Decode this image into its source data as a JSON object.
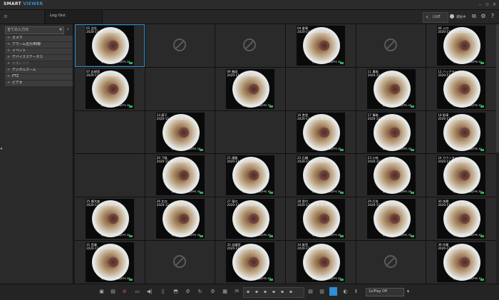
{
  "app": {
    "brand_main": "SMART",
    "brand_sub": "VIEWER"
  },
  "toolbar": {
    "tab_label": "Log Out",
    "status_label": "運転中"
  },
  "sidebar": {
    "selector_value": "全ての入力元",
    "items": [
      {
        "label": "カメラ",
        "enabled": true
      },
      {
        "label": "アラーム出力/制御",
        "enabled": true
      },
      {
        "label": "イベント",
        "enabled": true
      },
      {
        "label": "デバイスステータス",
        "enabled": true
      },
      {
        "label": "お気に入り",
        "enabled": false
      },
      {
        "label": "デジタルズーム",
        "enabled": true
      },
      {
        "label": "PTZ",
        "enabled": true
      },
      {
        "label": "ビデオ",
        "enabled": true
      }
    ]
  },
  "grid": {
    "cells": [
      {
        "label": "01 会社",
        "time": "2020-11-26 11:04:25",
        "status": "帯域 38.3 Mbps/FPS 30",
        "selected": true
      },
      {
        "empty": true
      },
      {
        "empty": true
      },
      {
        "label": "04 倉庫",
        "time": "2020-11-26 11:04:25",
        "status": "帯域 38.3 Mbps/FPS 30"
      },
      {
        "empty": true
      },
      {
        "label": "06 入口",
        "time": "2020-11-26 11:04:25",
        "status": "帯域 38.3 Mbps/FPS 30"
      },
      {
        "label": "07 応接室",
        "time": "2020-11-26 11:04:25",
        "status": "帯域 38.3 Mbps/FPS 30"
      },
      {
        "blank": true
      },
      {
        "label": "09 階段",
        "time": "2020-11-26 11:04:25",
        "status": "帯域 38.3 Mbps/FPS 30"
      },
      {
        "blank": true
      },
      {
        "label": "11 事務",
        "time": "2020-11-26 11:04:25",
        "status": "帯域 38.3 Mbps/FPS 30"
      },
      {
        "label": "12 バックヤード",
        "time": "2020-11-26 11:04:25",
        "status": "帯域 38.3 Mbps/FPS 30"
      },
      {
        "blank": true
      },
      {
        "label": "14 廊下",
        "time": "2020-11-26 11:04:25",
        "status": "帯域 38.3 Mbps/FPS 30"
      },
      {
        "blank": true
      },
      {
        "label": "16 食堂",
        "time": "2020-11-26 11:04:25",
        "status": "帯域 38.3 Mbps/FPS 30"
      },
      {
        "label": "17 事務",
        "time": "2020-11-26 11:04:25",
        "status": "帯域 38.3 Mbps/FPS 30"
      },
      {
        "label": "18 駐車",
        "time": "2020-11-26 11:04:25",
        "status": "帯域 38.3 Mbps/FPS 30"
      },
      {
        "blank": true
      },
      {
        "label": "20 下駄",
        "time": "2020-11-26 11:04:25",
        "status": "帯域 38.3 Mbps/FPS 30"
      },
      {
        "label": "21 通路",
        "time": "2020-11-26 11:04:25",
        "status": "帯域 38.3 Mbps/FPS 30"
      },
      {
        "label": "22 石橋",
        "time": "2020-11-26 11:04:25",
        "status": "帯域 38.3 Mbps/FPS 30"
      },
      {
        "label": "23 小林",
        "time": "2020-11-26 11:04:25",
        "status": "帯域 38.3 Mbps/FPS 30"
      },
      {
        "label": "24 カウンター",
        "time": "2020-11-26 11:04:25",
        "status": "帯域 38.3 Mbps/FPS 30"
      },
      {
        "label": "25 横大座",
        "time": "2020-11-26 11:04:25",
        "status": "帯域 38.3 Mbps/FPS 30"
      },
      {
        "label": "26 北口",
        "time": "2020-11-26 11:04:25",
        "status": "帯域 38.3 Mbps/FPS 30"
      },
      {
        "label": "27 東口",
        "time": "2020-11-26 11:04:25",
        "status": "帯域 38.3 Mbps/FPS 30"
      },
      {
        "label": "28 受付",
        "time": "2020-11-26 11:04:25",
        "status": "帯域 38.3 Mbps/FPS 30"
      },
      {
        "label": "29 打合",
        "time": "2020-11-26 11:04:25",
        "status": "帯域 38.3 Mbps/FPS 30"
      },
      {
        "label": "30 休憩",
        "time": "2020-11-26 11:04:25",
        "status": "帯域 38.3 Mbps/FPS 30"
      },
      {
        "label": "31 営業",
        "time": "2020-11-26 11:04:25",
        "status": "帯域 38.3 Mbps/FPS 30"
      },
      {
        "empty": true
      },
      {
        "label": "33 会議室",
        "time": "2020-11-26 11:04:25",
        "status": "帯域 38.3 Mbps/FPS 30"
      },
      {
        "label": "34 販売",
        "time": "2020-11-26 11:04:25",
        "status": "帯域 38.3 Mbps/FPS 30"
      },
      {
        "empty": true
      },
      {
        "label": "36 作業",
        "time": "2020-11-26 11:04:25",
        "status": "帯域 38.3 Mbps/FPS 30"
      }
    ]
  },
  "bottombar": {
    "layout_label": "36",
    "speed_select": "1x/Play Off"
  },
  "colors": {
    "accent": "#2e8fd6",
    "background": "#1b1b1b",
    "panel": "#2a2a2a",
    "recording": "#2fae5a"
  }
}
